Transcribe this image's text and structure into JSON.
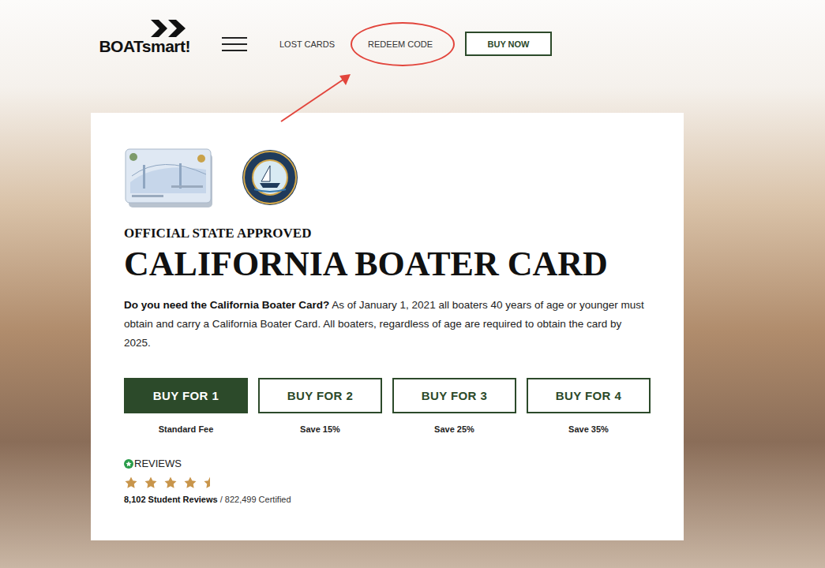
{
  "logo": {
    "text": "BOATsmart!"
  },
  "nav": {
    "links": [
      {
        "label": "LOST CARDS",
        "highlighted": false
      },
      {
        "label": "REDEEM CODE",
        "highlighted": true
      }
    ],
    "cta": "BUY NOW"
  },
  "hero": {
    "eyebrow": "OFFICIAL STATE APPROVED",
    "title": "CALIFORNIA BOATER CARD",
    "intro_lead": "Do you need the California Boater Card?",
    "intro": "As of January 1, 2021 all boaters 40 years of age or younger must obtain and carry a California Boater Card. All boaters, regardless of age are required to obtain the card by 2025."
  },
  "options": [
    {
      "label": "BUY FOR 1",
      "note": "Standard Fee",
      "selected": true
    },
    {
      "label": "BUY FOR 2",
      "note": "Save 15%",
      "selected": false
    },
    {
      "label": "BUY FOR 3",
      "note": "Save 25%",
      "selected": false
    },
    {
      "label": "BUY FOR 4",
      "note": "Save 35%",
      "selected": false
    }
  ],
  "reviews": {
    "label": "REVIEWS",
    "stars": 4.5,
    "count": "8,102 Student Reviews",
    "certified": "/ 822,499 Certified"
  }
}
